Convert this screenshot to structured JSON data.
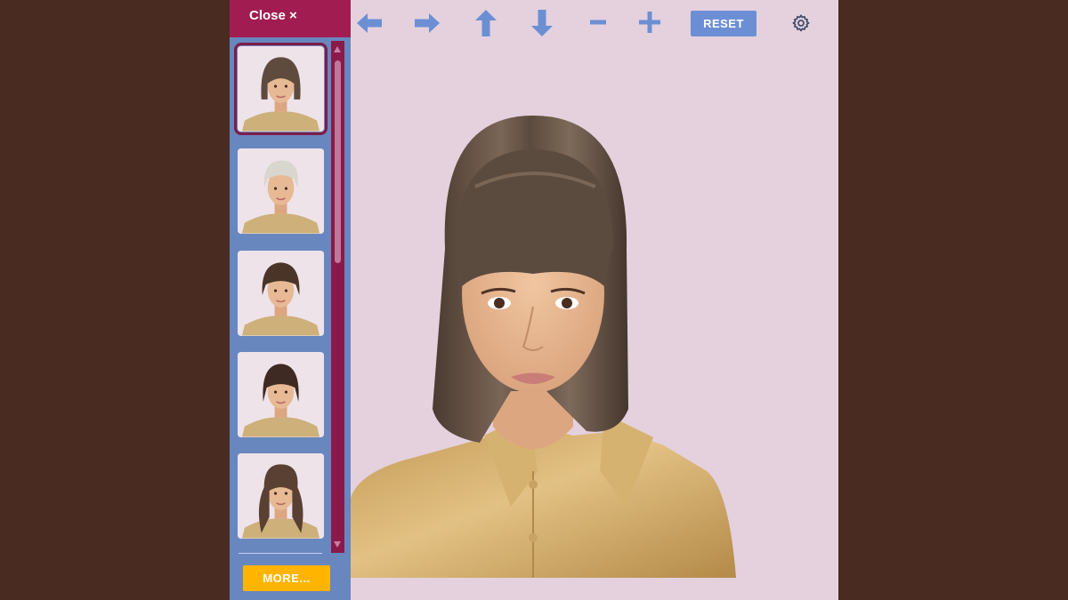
{
  "sidebar": {
    "close_label": "Close ×",
    "more_label": "MORE...",
    "thumbnails": [
      {
        "style": "bob-with-bangs",
        "hair_color": "#5e4b3e",
        "selected": true
      },
      {
        "style": "short-pixie",
        "hair_color": "#d9d6cf",
        "selected": false
      },
      {
        "style": "short-bowl-cut",
        "hair_color": "#4a3428",
        "selected": false
      },
      {
        "style": "short-bob",
        "hair_color": "#3e2a22",
        "selected": false
      },
      {
        "style": "long-wavy-with-bangs",
        "hair_color": "#5a4032",
        "selected": false
      }
    ]
  },
  "toolbar": {
    "left_icon": "arrow-left-icon",
    "right_icon": "arrow-right-icon",
    "up_icon": "arrow-up-icon",
    "down_icon": "arrow-down-icon",
    "zoom_out_icon": "minus-icon",
    "zoom_in_icon": "plus-icon",
    "reset_label": "RESET",
    "settings_icon": "gear-icon"
  },
  "colors": {
    "accent": "#6c8fd4",
    "sidebar": "#6987bf",
    "close_bar": "#a11d51",
    "more_button": "#ffb400",
    "canvas": "#e4d1dd",
    "page_background": "#4a2b21"
  }
}
